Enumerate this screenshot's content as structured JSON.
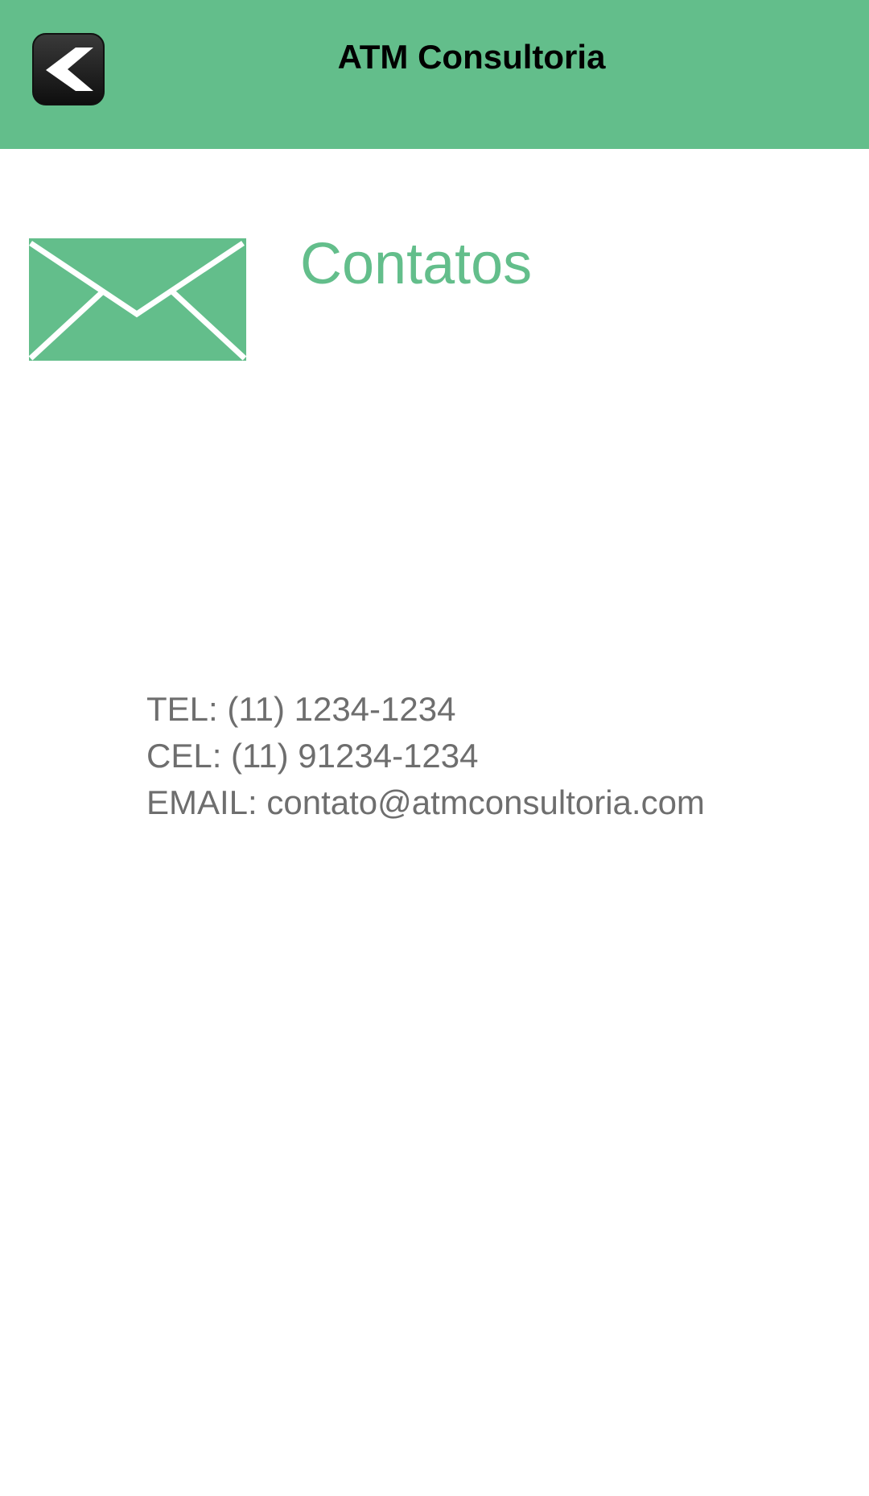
{
  "app_bar": {
    "title": "ATM Consultoria",
    "back_icon": "chevron-left-icon",
    "background_color": "#63be8b"
  },
  "section": {
    "icon": "envelope-icon",
    "title": "Contatos",
    "title_color": "#63be8b"
  },
  "contacts": {
    "tel": "TEL: (11) 1234-1234",
    "cel": "CEL: (11) 91234-1234",
    "email": "EMAIL: contato@atmconsultoria.com",
    "text_color": "#6e6e6e"
  }
}
